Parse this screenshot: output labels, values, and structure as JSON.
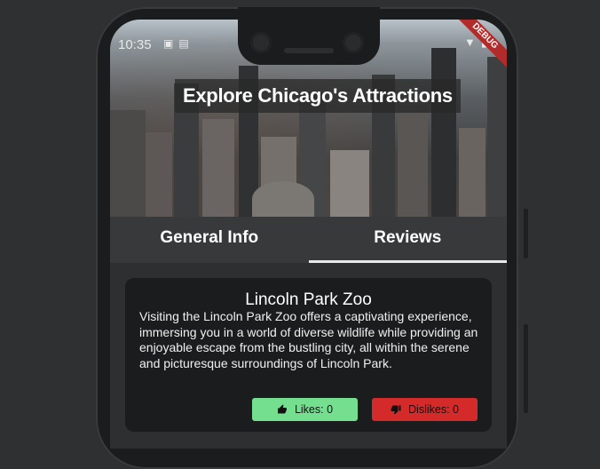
{
  "status_bar": {
    "time": "10:35"
  },
  "debug_banner": "DEBUG",
  "header": {
    "title": "Explore Chicago's Attractions"
  },
  "tabs": [
    {
      "label": "General Info",
      "active": false
    },
    {
      "label": "Reviews",
      "active": true
    }
  ],
  "attraction": {
    "name": "Lincoln Park Zoo",
    "description": "Visiting the Lincoln Park Zoo offers a captivating experience, immersing you in a world of diverse wildlife while providing an enjoyable escape from the bustling city, all within the serene and picturesque surroundings of Lincoln Park.",
    "likes_label": "Likes: 0",
    "dislikes_label": "Dislikes: 0"
  },
  "colors": {
    "like_button": "#74e08f",
    "dislike_button": "#d42a2a",
    "card_bg": "#1b1c1d",
    "tab_bar_bg": "#37393b"
  }
}
